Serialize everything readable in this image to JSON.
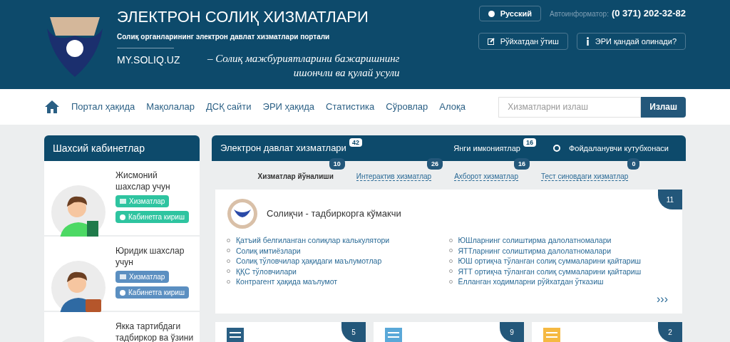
{
  "header": {
    "title": "ЭЛЕКТРОН СОЛИҚ ХИЗМАТЛАРИ",
    "subtitle": "Солиқ органларининг электрон давлат хизматлари портали",
    "site": "MY.SOLIQ.UZ",
    "tagline": "– Солиқ мажбуриятларини бажаришнинг ишончли ва қулай усули",
    "language": "Русский",
    "phone_label": "Автоинформатор:",
    "phone": "(0 371) 202-32-82",
    "buttons": [
      "Рўйхатдан ўтиш",
      "ЭРИ қандай олинади?"
    ]
  },
  "nav": {
    "items": [
      "Портал ҳақида",
      "Мақолалар",
      "ДСҚ сайти",
      "ЭРИ ҳақида",
      "Статистика",
      "Сўровлар",
      "Алоқа"
    ],
    "search": {
      "placeholder": "Хизматларни излаш",
      "button": "Излаш"
    }
  },
  "sidebar": {
    "title": "Шахсий кабинетлар",
    "items": [
      {
        "title": "Жисмоний шахслар учун",
        "color": "#2ec4a0",
        "links": [
          "Хизматлар",
          "Кабинетга кириш"
        ]
      },
      {
        "title": "Юридик шахслар учун",
        "color": "#5b8fc1",
        "links": [
          "Хизматлар",
          "Кабинетга кириш"
        ]
      },
      {
        "title": "Якка тартибдаги тадбиркор ва ўзини"
      }
    ]
  },
  "services": {
    "title": "Электрон давлат хизматлари",
    "count": "42",
    "new_label": "Янги имкониятлар",
    "new_count": "16",
    "library": "Фойдаланувчи кутубхонаси",
    "tabs": [
      {
        "label": "Хизматлар йўналиши",
        "count": "10",
        "selected": true
      },
      {
        "label": "Интерактив хизматлар",
        "count": "26",
        "selected": false
      },
      {
        "label": "Ахборот хизматлар",
        "count": "16",
        "selected": false
      },
      {
        "label": "Тест синовдаги хизматлар",
        "count": "0",
        "selected": false
      }
    ],
    "featured": {
      "title": "Солиқчи - тадбиркорга кўмакчи",
      "count": "11",
      "links": [
        "Қатъий белгиланган солиқлар калькулятори",
        "Солиқ имтиёзлари",
        "Солиқ тўловчилар ҳақидаги маълумотлар",
        "ҚҚС тўловчилари",
        "Контрагент ҳақида маълумот",
        "ЮШларнинг солиштирма далолатномалари",
        "ЯТТларнинг солиштирма далолатномалари",
        "ЮШ ортиқча тўланган солиқ суммаларини қайтариш",
        "ЯТТ ортиқча тўланган солиқ суммаларини қайтариш",
        "Ёлланган ходимларни рўйхатдан ўтказиш"
      ],
      "more": "›››"
    },
    "cards": [
      {
        "count": "5"
      },
      {
        "count": "9"
      },
      {
        "count": "2"
      }
    ]
  }
}
